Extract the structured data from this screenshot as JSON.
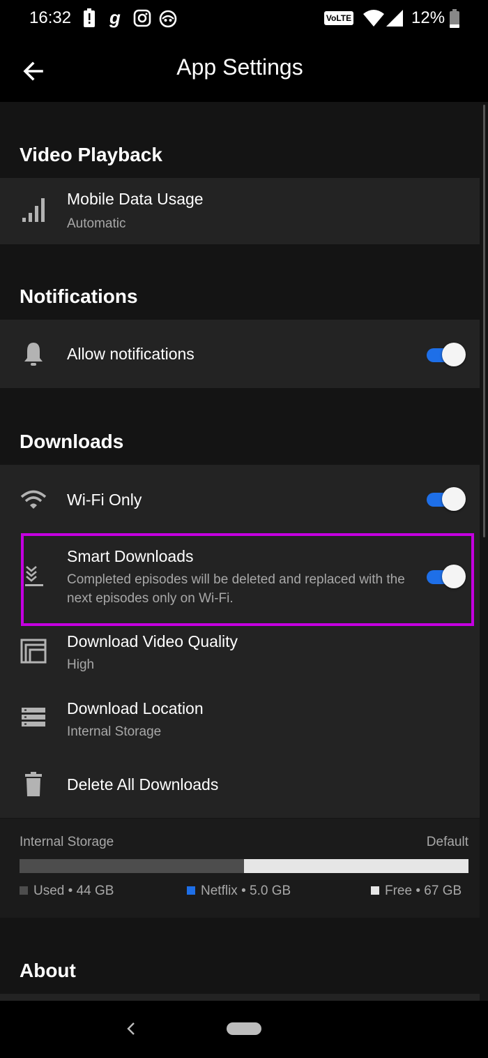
{
  "status_bar": {
    "time": "16:32",
    "network": "VoLTE",
    "battery": "12%",
    "icons": [
      "battery-alert-icon",
      "g-icon",
      "instagram-icon",
      "bot-icon",
      "wifi-icon",
      "cell-signal-icon",
      "battery-icon"
    ]
  },
  "app_bar": {
    "title": "App Settings",
    "back_icon": "arrow-back-icon"
  },
  "sections": {
    "video_playback": {
      "heading": "Video Playback",
      "mobile_data": {
        "title": "Mobile Data Usage",
        "value": "Automatic",
        "icon": "signal-bars-icon"
      }
    },
    "notifications": {
      "heading": "Notifications",
      "allow": {
        "title": "Allow notifications",
        "enabled": true,
        "icon": "bell-icon"
      }
    },
    "downloads": {
      "heading": "Downloads",
      "wifi_only": {
        "title": "Wi-Fi Only",
        "enabled": true,
        "icon": "wifi-icon"
      },
      "smart_downloads": {
        "title": "Smart Downloads",
        "description": "Completed episodes will be deleted and replaced with the next episodes only on Wi-Fi.",
        "enabled": true,
        "icon": "smart-download-icon"
      },
      "video_quality": {
        "title": "Download Video Quality",
        "value": "High",
        "icon": "quality-icon"
      },
      "location": {
        "title": "Download Location",
        "value": "Internal Storage",
        "icon": "storage-icon"
      },
      "delete_all": {
        "title": "Delete All Downloads",
        "icon": "trash-icon"
      }
    },
    "storage": {
      "label": "Internal Storage",
      "default_label": "Default",
      "used_fraction": 0.5,
      "netflix_fraction": 0.0,
      "legend": {
        "used": "Used • 44 GB",
        "netflix": "Netflix • 5.0 GB",
        "free": "Free • 67 GB"
      },
      "colors": {
        "used": "#4d4d4d",
        "netflix": "#1e6fe8",
        "free": "#e6e6e6"
      }
    },
    "about": {
      "heading": "About"
    }
  },
  "accent_color": "#1e6fe8",
  "highlight_color": "#c400e0"
}
